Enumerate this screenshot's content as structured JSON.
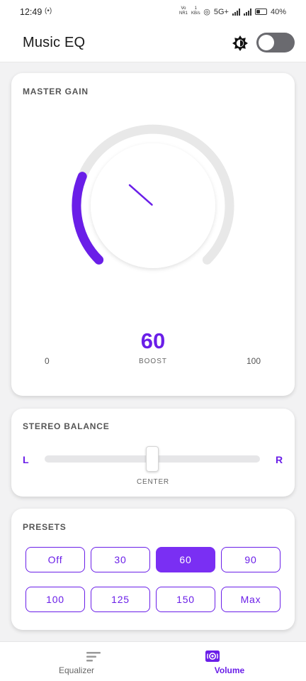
{
  "status": {
    "time": "12:49",
    "network_label": "Vo\nNR1",
    "speed_label": "1\nKB/s",
    "network_type": "5G+",
    "battery": "40%",
    "battery_level": 0.4
  },
  "appbar": {
    "title": "Music EQ",
    "theme_icon": "brightness-icon",
    "dark_mode_enabled": false
  },
  "master_gain": {
    "title": "MASTER GAIN",
    "value": "60",
    "label": "BOOST",
    "min_label": "0",
    "max_label": "100"
  },
  "stereo_balance": {
    "title": "STEREO BALANCE",
    "left_label": "L",
    "right_label": "R",
    "position_label": "CENTER",
    "value": 0.5
  },
  "presets": {
    "title": "PRESETS",
    "items": [
      "Off",
      "30",
      "60",
      "90",
      "100",
      "125",
      "150",
      "Max"
    ],
    "selected": "60"
  },
  "bottom_nav": {
    "items": [
      {
        "label": "Equalizer",
        "icon": "equalizer-icon",
        "active": false
      },
      {
        "label": "Volume",
        "icon": "volume-icon",
        "active": true
      }
    ]
  },
  "colors": {
    "accent": "#6a1ee8",
    "accent_fill": "#7a2ff3",
    "track": "#e6e6e8"
  }
}
